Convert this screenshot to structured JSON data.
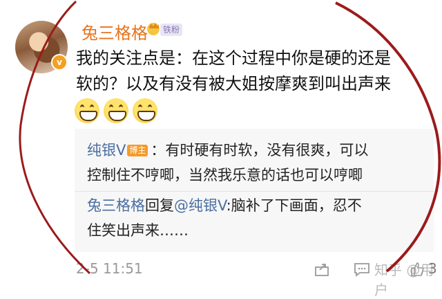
{
  "comment": {
    "username": "兔三格格",
    "fan_badge": "铁粉",
    "verified_mark": "v",
    "text_line1": "我的关注点是：在这个过程中你是硬的还是",
    "text_line2": "软的？以及有没有被大姐按摩爽到叫出声来",
    "emojis": [
      "grin",
      "grin",
      "grin"
    ]
  },
  "replies": {
    "first": {
      "author": "纯银V",
      "badge": "博主",
      "text_line1": "：有时硬有时软，没有很爽，可以",
      "text_line2": "控制住不哼唧，当然我乐意的话也可以哼唧"
    },
    "second": {
      "author": "兔三格格",
      "reply_word": "回复",
      "mention": "@纯银V",
      "text_line1": ":脑补了下画面，忍不",
      "text_line2": "住笑出声来……"
    }
  },
  "footer": {
    "timestamp": "2-5 11:51",
    "like_count": "3",
    "watermark": "知乎 @用户"
  },
  "colors": {
    "username": "#e8731a",
    "link": "#4a6ea0",
    "annotation_circle": "#9b1b1b"
  }
}
